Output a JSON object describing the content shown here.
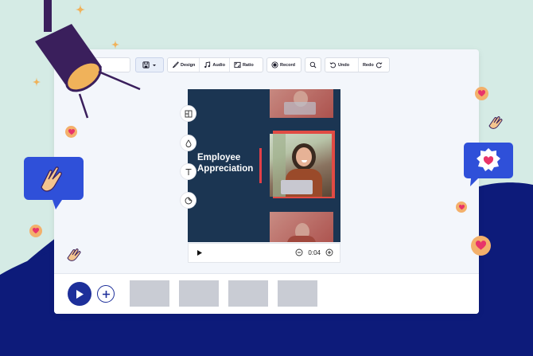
{
  "toolbar": {
    "design_label": "Design",
    "audio_label": "Audio",
    "ratio_label": "Ratio",
    "record_label": "Record",
    "undo_label": "Undo",
    "redo_label": "Redo"
  },
  "preview": {
    "title": "Employee Appreciation",
    "time": "0:04"
  },
  "timeline": {
    "thumbnail_count": 4
  },
  "colors": {
    "background": "#d5ebe5",
    "wave": "#0d1b7a",
    "preview_bg": "#1b3552",
    "accent": "#e23f47",
    "play_button": "#1d2f9a",
    "bubble": "#2f50d9",
    "spotlight": "#3a1f5c"
  }
}
